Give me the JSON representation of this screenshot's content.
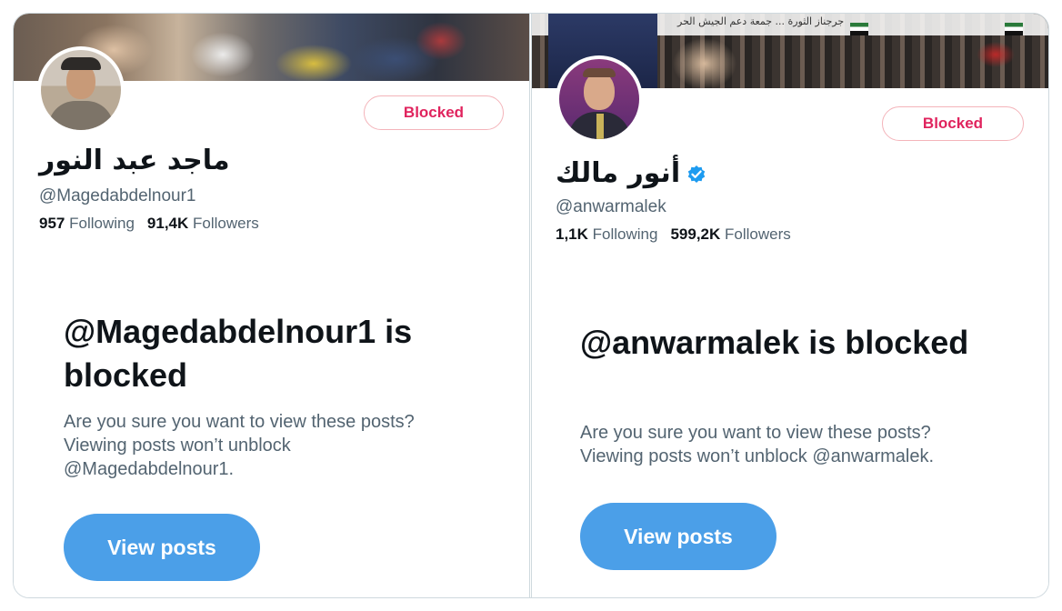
{
  "profiles": [
    {
      "display_name": "ماجد عبد النور",
      "handle": "@Magedabdelnour1",
      "following_count": "957",
      "following_label": "Following",
      "followers_count": "91,4K",
      "followers_label": "Followers",
      "blocked_label": "Blocked",
      "blocked_title": "@Magedabdelnour1 is blocked",
      "blocked_description_line1": "Are you sure you want to view these posts?",
      "blocked_description_line2": "Viewing posts won’t unblock",
      "blocked_description_line3": "@Magedabdelnour1.",
      "view_posts_label": "View posts",
      "verified": false
    },
    {
      "display_name": "أنور مالك",
      "handle": "@anwarmalek",
      "following_count": "1,1K",
      "following_label": "Following",
      "followers_count": "599,2K",
      "followers_label": "Followers",
      "blocked_label": "Blocked",
      "blocked_title": "@anwarmalek is blocked",
      "blocked_description_line1": "Are you sure you want to view these posts?",
      "blocked_description_line2": "Viewing posts won’t unblock @anwarmalek.",
      "view_posts_label": "View posts",
      "verified": true,
      "banner_sign_text": "جرجناز الثورة ... جمعة دعم الجيش الحر"
    }
  ],
  "colors": {
    "blocked_red": "#e0245e",
    "primary_blue": "#4b9fe8",
    "verified_blue": "#1d9bf0",
    "secondary_text": "#536471"
  }
}
